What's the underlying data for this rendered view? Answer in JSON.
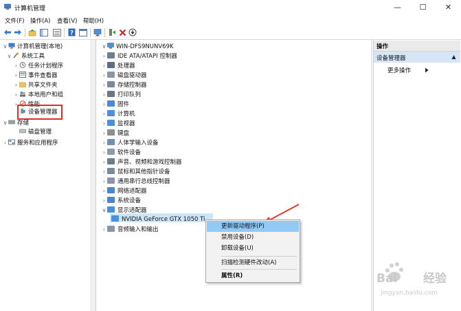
{
  "window": {
    "title": "计算机管理",
    "controls": [
      "—",
      "☐",
      "✕"
    ]
  },
  "menubar": [
    "文件(F)",
    "操作(A)",
    "查看(V)",
    "帮助(H)"
  ],
  "left_tree": {
    "root": "计算机管理(本地)",
    "system_tools": "系统工具",
    "items": [
      "任务计划程序",
      "事件查看器",
      "共享文件夹",
      "本地用户和组",
      "性能",
      "设备管理器"
    ],
    "storage": "存储",
    "disk_management": "磁盘管理",
    "services": "服务和应用程序"
  },
  "device_tree": {
    "computer": "WIN-DFS9NUNV69K",
    "categories": [
      "IDE ATA/ATAPI 控制器",
      "处理器",
      "磁盘驱动器",
      "存储控制器",
      "打印队列",
      "固件",
      "计算机",
      "监视器",
      "键盘",
      "人体学输入设备",
      "软件设备",
      "声音、视频和游戏控制器",
      "鼠标和其他指针设备",
      "通用串行总线控制器",
      "网络适配器",
      "系统设备",
      "显示适配器"
    ],
    "display_child": "NVIDIA GeForce GTX 1050 Ti",
    "after": "音频输入和输出"
  },
  "actions_pane": {
    "header": "操作",
    "section": "设备管理器",
    "more": "更多操作"
  },
  "context_menu": {
    "update": "更新驱动程序(P)",
    "disable": "禁用设备(D)",
    "uninstall": "卸载设备(U)",
    "scan": "扫描检测硬件改动(A)",
    "properties": "属性(R)"
  },
  "watermark": {
    "text": "Bai",
    "text2": "经验",
    "url": "jingyan.baidu.com"
  },
  "colors": {
    "highlight_box": "#d9302a",
    "selected_row": "#cde6f7",
    "menu_hover": "#91c9f7",
    "arrow": "#e23a2e"
  }
}
